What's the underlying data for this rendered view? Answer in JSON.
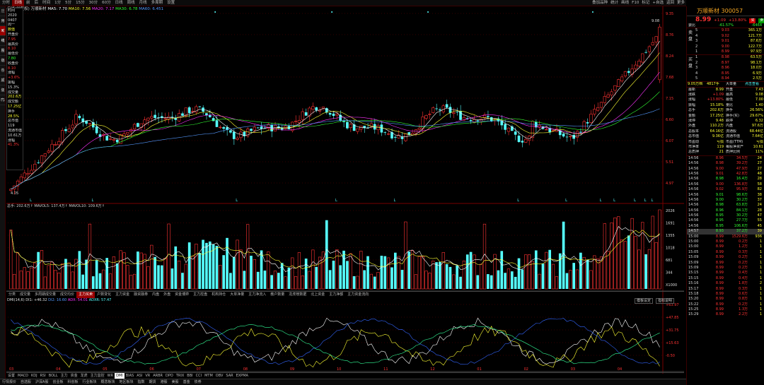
{
  "topbar": {
    "items": [
      "分时",
      "日线",
      "前",
      "后",
      "时间",
      "1分",
      "5分",
      "15分",
      "30分",
      "60分",
      "日线",
      "周线",
      "月线",
      "多周期",
      "设置"
    ],
    "active": 1,
    "right": [
      "叠加品种",
      "统计",
      "画线",
      "F10",
      "标记",
      "+自选",
      "返回",
      "更多"
    ]
  },
  "leftstrip": [
    "应用",
    "分时图",
    "K线图",
    "个股资料",
    "自选股",
    "综合排名",
    "牛叉诊股",
    "超级盘口",
    "主力大单",
    "F10"
  ],
  "leftstrip_active": 2,
  "ma_legend": {
    "period": "日线(前复权)",
    "stock": "万顺新材",
    "ma5": "MA5: 7.70",
    "ma10": "MA10: 7.56",
    "ma20": "MA20: 7.17",
    "ma30": "MA30: 6.78",
    "ma60": "MA60: 6.451"
  },
  "info_panel": [
    [
      "时间",
      "wht"
    ],
    [
      "2020",
      "wht"
    ],
    [
      "0407",
      "wht"
    ],
    [
      "周一",
      "wht"
    ],
    [
      "数值",
      "yel"
    ],
    [
      "",
      "wht"
    ],
    [
      "开盘价",
      "wht"
    ],
    [
      "7.95",
      "red"
    ],
    [
      "最高价",
      "wht"
    ],
    [
      "8.10",
      "red"
    ],
    [
      "最低价",
      "wht"
    ],
    [
      "7.80",
      "grn"
    ],
    [
      "收盘价",
      "wht"
    ],
    [
      "8.10",
      "red"
    ],
    [
      "涨幅",
      "wht"
    ],
    [
      "+3.6%",
      "red"
    ],
    [
      "振幅",
      "wht"
    ],
    [
      "15.3%",
      "wht"
    ],
    [
      "成交量",
      "wht"
    ],
    [
      "202.6万",
      "yel"
    ],
    [
      "成交额",
      "wht"
    ],
    [
      "17.25亿",
      "yel"
    ],
    [
      "换手",
      "wht"
    ],
    [
      "28.5%",
      "yel"
    ],
    [
      "总市值",
      "wht"
    ],
    [
      "119",
      "wht"
    ],
    [
      "流通市值",
      "wht"
    ],
    [
      "10.61万",
      "wht"
    ],
    [
      "涨幅",
      "wht"
    ],
    [
      "41.3%",
      "red"
    ]
  ],
  "price_axis": [
    "9.35",
    "8.76",
    "8.24",
    "7.68",
    "7.15",
    "6.60",
    "6.07",
    "5.51",
    "4.97"
  ],
  "price_high_label": "9.08",
  "price_low_label": "4.05",
  "vol_legend": "总手: 202.6万↑ MAVOL5: 137.4万↑ MAVOL10: 109.6万↑",
  "vol_axis": [
    "2026",
    "1691",
    "1355",
    "1018",
    "681",
    "344",
    "X1000"
  ],
  "tabs": [
    "分类",
    "成交量",
    "多周期成交量",
    "成交均价",
    "主力买卖",
    "户数变化",
    "主力资金",
    "融资融券",
    "内盘",
    "外盘",
    "资金博弈",
    "主力控盘",
    "机构持仓",
    "大单净量",
    "主力净流入",
    "散户数量",
    "龙虎榜数据",
    "北上资金",
    "主力净额",
    "主力资金流向"
  ],
  "tab_active": 4,
  "dmi_legend": {
    "main": "DMI(14,6) DI1: +46.32",
    "di2": "DI2: 16.60",
    "adx": "ADX: 54.01",
    "adxr": "ADXR: 57.47"
  },
  "dmi_buttons": [
    "模板设定",
    "指标说明"
  ],
  "dmi_axis": [
    "+63.97",
    "+47.85",
    "+31.75",
    "+15.63",
    "-0.50"
  ],
  "date_labels": [
    "03",
    "04",
    "05",
    "06",
    "07",
    "08",
    "09",
    "10",
    "11",
    "12",
    "01",
    "02",
    "03",
    "04"
  ],
  "indicators": [
    "设置",
    "MACD",
    "KDJ",
    "RSI",
    "BOLL",
    "主力",
    "资金",
    "龙虎",
    "主力监控",
    "WR",
    "DMI",
    "BIAS",
    "ASI",
    "VR",
    "ARBR",
    "DPO",
    "TRIX",
    "BBI",
    "CCI",
    "MTM",
    "OBV",
    "SAR",
    "EXPMA"
  ],
  "indicator_active": 10,
  "bottom_tabs": [
    "行情报价",
    "自选股",
    "沪深A股",
    "创业板",
    "科创板",
    "行业板块",
    "概念板块",
    "地区板块",
    "指数",
    "期货",
    "港股",
    "美股",
    "基金",
    "债券"
  ],
  "stock": {
    "name": "万顺新材 300057",
    "price": "8.99",
    "change": "+1.09",
    "pct": "+13.80%",
    "tags": [
      "买",
      "卖"
    ]
  },
  "ratio": {
    "label": "委比",
    "value": "-61.57%",
    "diff": "-6464"
  },
  "sell": [
    [
      "5",
      "9.03",
      "365.1万"
    ],
    [
      "4",
      "9.02",
      "121.7万"
    ],
    [
      "3",
      "9.01",
      "87.6万"
    ],
    [
      "2",
      "9.00",
      "122.7万"
    ],
    [
      "1",
      "8.99",
      "97.9万"
    ]
  ],
  "buy": [
    [
      "1",
      "8.98",
      "63.5万"
    ],
    [
      "2",
      "8.97",
      "98.1万"
    ],
    [
      "3",
      "8.96",
      "18.0万"
    ],
    [
      "4",
      "8.95",
      "6.9万"
    ],
    [
      "5",
      "8.94",
      "2.5万"
    ]
  ],
  "stats_header": [
    "9.05万档",
    "4817手",
    "大单量",
    "点击查看"
  ],
  "stats": [
    [
      "最新",
      "8.99",
      "开盘",
      "7.43"
    ],
    [
      "涨跌",
      "+1.09",
      "最高",
      "9.08"
    ],
    [
      "涨幅",
      "+13.80%",
      "最低",
      "7.00"
    ],
    [
      "振幅",
      "15.18%",
      "量比",
      "1.40"
    ],
    [
      "总手",
      "202.6万",
      "换手",
      "26.56%"
    ],
    [
      "金额",
      "17.25亿",
      "换手(实)",
      "29.67%"
    ],
    [
      "涨停",
      "9.48",
      "跌停",
      "6.32"
    ],
    [
      "外盘",
      "110.2万",
      "内盘",
      "97.6万"
    ],
    [
      "总股本",
      "64.16亿",
      "流通股",
      "68.44亿"
    ],
    [
      "总市值",
      "9.36亿",
      "流通市值",
      "7.64亿"
    ],
    [
      "市盈动",
      "亏损",
      "市盈(TTM)",
      "亏损"
    ],
    [
      "市净率",
      "119",
      "每股净资产",
      "10.61"
    ],
    [
      "总质押",
      "21",
      "质押比例",
      "11%"
    ]
  ],
  "ticks": [
    [
      "14:56",
      "8.96",
      "34.5万",
      "24",
      "red"
    ],
    [
      "14:56",
      "8.98",
      "39.2万",
      "27",
      "red"
    ],
    [
      "14:56",
      "9.00",
      "47.9万",
      "27",
      "red"
    ],
    [
      "14:56",
      "9.01",
      "42.8万",
      "48",
      "red"
    ],
    [
      "14:56",
      "8.98",
      "16.4万",
      "28",
      "grn"
    ],
    [
      "14:56",
      "9.00",
      "136.8万",
      "58",
      "red"
    ],
    [
      "14:56",
      "9.02",
      "95.9万",
      "82",
      "red"
    ],
    [
      "14:56",
      "9.01",
      "98.6万",
      "38",
      "grn"
    ],
    [
      "14:56",
      "9.00",
      "30.2万",
      "37",
      "grn"
    ],
    [
      "14:56",
      "8.98",
      "63.8万",
      "24",
      "grn"
    ],
    [
      "14:56",
      "8.96",
      "84.1万",
      "28",
      "grn"
    ],
    [
      "14:56",
      "8.95",
      "30.2万",
      "47",
      "grn"
    ],
    [
      "14:56",
      "8.95",
      "27.7万",
      "55",
      "grn"
    ],
    [
      "14:56",
      "8.95",
      "106.6万",
      "45",
      "grn"
    ],
    [
      "14:57",
      "8.93",
      "37.2万",
      "39",
      "grn"
    ],
    [
      "15:00",
      "8.99",
      "1529.6万",
      "936",
      "red"
    ],
    [
      "15:00",
      "8.99",
      "0.2万",
      "1",
      "red"
    ],
    [
      "15:00",
      "8.99",
      "1.2万",
      "1",
      "red"
    ],
    [
      "15:05",
      "8.99",
      "0.3万",
      "1",
      "red"
    ],
    [
      "15:09",
      "8.99",
      "0.2万",
      "1",
      "red"
    ],
    [
      "15:09",
      "8.99",
      "0.2万",
      "1",
      "red"
    ],
    [
      "15:09",
      "8.99",
      "0.2万",
      "1",
      "red"
    ],
    [
      "15:15",
      "8.99",
      "0.4万",
      "1",
      "red"
    ],
    [
      "15:15",
      "8.99",
      "0.4万",
      "1",
      "red"
    ],
    [
      "15:16",
      "8.99",
      "1.8万",
      "2",
      "red"
    ],
    [
      "15:17",
      "8.99",
      "0.3万",
      "1",
      "red"
    ],
    [
      "15:18",
      "8.99",
      "0.6万",
      "1",
      "red"
    ],
    [
      "15:20",
      "8.99",
      "0.8万",
      "1",
      "red"
    ],
    [
      "15:22",
      "8.99",
      "0.2万",
      "1",
      "red"
    ],
    [
      "15:25",
      "8.99",
      "1.3万",
      "1",
      "red"
    ],
    [
      "15:29",
      "8.99",
      "2.2万",
      "1",
      "red"
    ]
  ],
  "tick_highlight": 14,
  "colors": {
    "up": "#ff3333",
    "down": "#55ffff",
    "ma5": "#ffffff",
    "ma10": "#ffff33",
    "ma20": "#ff33ff",
    "ma30": "#33ff33",
    "ma60": "#5599ff"
  }
}
